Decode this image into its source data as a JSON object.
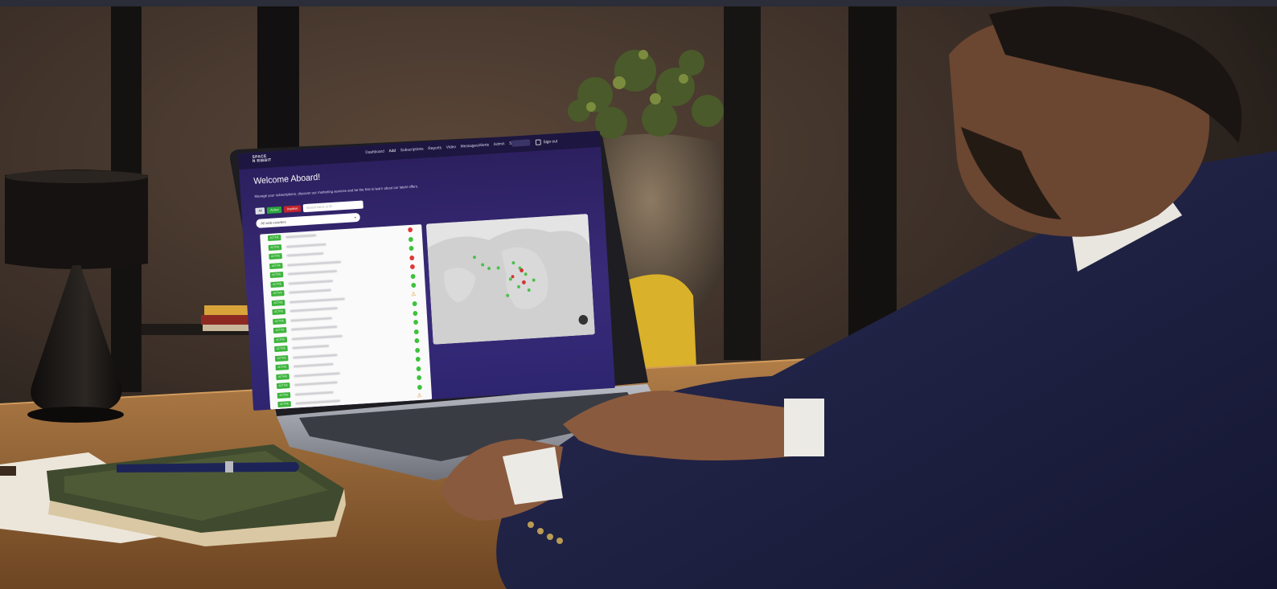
{
  "laptop_screen": {
    "brand_line1": "SPACE",
    "brand_line2": "N  RIBBIT",
    "nav_items": [
      "Dashboard",
      "Add",
      "Subscriptions",
      "Reports",
      "Video",
      "Messages/Alerts",
      "Admin",
      "Support"
    ],
    "signout_label": "Sign out",
    "welcome_title": "Welcome Aboard!",
    "subtitle": "Manage your subscriptions, discover our marketing services and be the first to learn about our latest offers.",
    "filter_all": "All",
    "filter_active": "Active",
    "filter_inactive": "Inactive",
    "search_placeholder": "Search name or ID",
    "select_label": "All web-crawlers",
    "status_colors": {
      "active": "#3ec23c",
      "inactive": "#e0383a",
      "warning": "#e38b18"
    },
    "rows": [
      {
        "tag": "ACTIVE",
        "status": "red"
      },
      {
        "tag": "ACTIVE",
        "status": "green"
      },
      {
        "tag": "ACTIVE",
        "status": "green"
      },
      {
        "tag": "ACTIVE",
        "status": "red"
      },
      {
        "tag": "ACTIVE",
        "status": "red"
      },
      {
        "tag": "ACTIVE",
        "status": "green"
      },
      {
        "tag": "ACTIVE",
        "status": "green"
      },
      {
        "tag": "ACTIVE",
        "status": "warning"
      },
      {
        "tag": "ACTIVE",
        "status": "green"
      },
      {
        "tag": "ACTIVE",
        "status": "green"
      },
      {
        "tag": "ACTIVE",
        "status": "green"
      },
      {
        "tag": "ACTIVE",
        "status": "green"
      },
      {
        "tag": "ACTIVE",
        "status": "green"
      },
      {
        "tag": "ACTIVE",
        "status": "green"
      },
      {
        "tag": "ACTIVE",
        "status": "green"
      },
      {
        "tag": "ACTIVE",
        "status": "green"
      },
      {
        "tag": "ACTIVE",
        "status": "green"
      },
      {
        "tag": "ACTIVE",
        "status": "green"
      },
      {
        "tag": "ACTIVE",
        "status": "warning"
      }
    ]
  }
}
